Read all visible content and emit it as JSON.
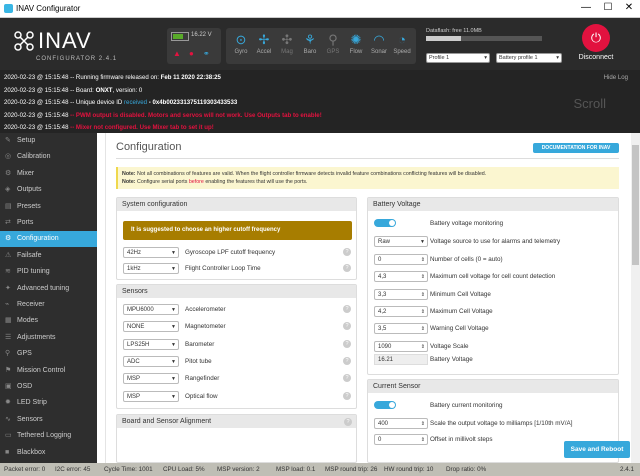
{
  "window": {
    "title": "INAV Configurator",
    "controls": [
      "—",
      "☐",
      "✕"
    ]
  },
  "header": {
    "logo_text": "INAV",
    "logo_sub": "CONFIGURATOR 2.4.1",
    "battery": {
      "voltage": "16.22 V",
      "level": 0.75
    },
    "sensors": [
      {
        "name": "Gyro",
        "icon": "gyro-icon",
        "glyph": "⊙",
        "active": true
      },
      {
        "name": "Accel",
        "icon": "accel-icon",
        "glyph": "✢",
        "active": true
      },
      {
        "name": "Mag",
        "icon": "mag-icon",
        "glyph": "✣",
        "active": false
      },
      {
        "name": "Baro",
        "icon": "baro-icon",
        "glyph": "⚘",
        "active": true
      },
      {
        "name": "GPS",
        "icon": "gps-icon",
        "glyph": "⚲",
        "active": false
      },
      {
        "name": "Flow",
        "icon": "flow-icon",
        "glyph": "✺",
        "active": true
      },
      {
        "name": "Sonar",
        "icon": "sonar-icon",
        "glyph": "◠",
        "active": true
      },
      {
        "name": "Speed",
        "icon": "speed-icon",
        "glyph": "◔",
        "active": true
      }
    ],
    "dataflash": {
      "label": "Dataflash: free 11.0MB",
      "fraction": 0.3
    },
    "profile": "Profile 1",
    "battery_profile": "Battery profile 1",
    "disconnect_label": "Disconnect",
    "accent": "#e2123f"
  },
  "log": {
    "hide": "Hide Log",
    "scroll": "Scroll",
    "lines": [
      {
        "ts": "2020-02-23 @ 15:15:48",
        "msg": "-- Running firmware released on: ",
        "val": "Feb 11 2020 22:38:25",
        "type": "normal"
      },
      {
        "ts": "2020-02-23 @ 15:15:48",
        "msg": "-- Board: ",
        "val": "ONXT",
        "tail": ", version: 0",
        "type": "normal"
      },
      {
        "ts": "2020-02-23 @ 15:15:48",
        "msg": "-- Unique device ID ",
        "blue": "received",
        "val": " - 0x4b002331375119303433533",
        "type": "normal"
      },
      {
        "ts": "2020-02-23 @ 15:15:48",
        "msg": "-- PWM output is disabled. Motors and servos will not work. Use Outputs tab to enable!",
        "type": "warn"
      },
      {
        "ts": "2020-02-23 @ 15:15:48",
        "msg": "-- Mixer not configured. Use Mixer tab to set it up!",
        "type": "warn"
      }
    ]
  },
  "sidebar": {
    "items": [
      {
        "label": "Setup",
        "icon": "wrench-icon",
        "glyph": "✎"
      },
      {
        "label": "Calibration",
        "icon": "calibration-icon",
        "glyph": "◎"
      },
      {
        "label": "Mixer",
        "icon": "mixer-icon",
        "glyph": "⚙"
      },
      {
        "label": "Outputs",
        "icon": "outputs-icon",
        "glyph": "◈"
      },
      {
        "label": "Presets",
        "icon": "presets-icon",
        "glyph": "▤"
      },
      {
        "label": "Ports",
        "icon": "ports-icon",
        "glyph": "⇄"
      },
      {
        "label": "Configuration",
        "icon": "gear-icon",
        "glyph": "⚙",
        "active": true
      },
      {
        "label": "Failsafe",
        "icon": "failsafe-icon",
        "glyph": "⚠"
      },
      {
        "label": "PID tuning",
        "icon": "pid-icon",
        "glyph": "≋"
      },
      {
        "label": "Advanced tuning",
        "icon": "advanced-icon",
        "glyph": "✦"
      },
      {
        "label": "Receiver",
        "icon": "receiver-icon",
        "glyph": "⌁"
      },
      {
        "label": "Modes",
        "icon": "modes-icon",
        "glyph": "▦"
      },
      {
        "label": "Adjustments",
        "icon": "adjustments-icon",
        "glyph": "☰"
      },
      {
        "label": "GPS",
        "icon": "gps-icon",
        "glyph": "⚲"
      },
      {
        "label": "Mission Control",
        "icon": "mission-icon",
        "glyph": "⚑"
      },
      {
        "label": "OSD",
        "icon": "osd-icon",
        "glyph": "▣"
      },
      {
        "label": "LED Strip",
        "icon": "led-icon",
        "glyph": "✹"
      },
      {
        "label": "Sensors",
        "icon": "sensors-icon",
        "glyph": "∿"
      },
      {
        "label": "Tethered Logging",
        "icon": "logging-icon",
        "glyph": "▭"
      },
      {
        "label": "Blackbox",
        "icon": "blackbox-icon",
        "glyph": "■"
      }
    ]
  },
  "content": {
    "title": "Configuration",
    "doc_button": "DOCUMENTATION FOR INAV",
    "note1_b": "Note:",
    "note1": " Not all combinations of features are valid. When the flight controller firmware detects invalid feature combinations conflicting features will be disabled.",
    "note2_b": "Note:",
    "note2_a": " Configure serial ports ",
    "note2_w": "before",
    "note2_c": " enabling the features that will use the ports.",
    "system": {
      "title": "System configuration",
      "warn": "It is suggested to choose an higher cutoff frequency",
      "rows": [
        {
          "value": "42Hz",
          "label": "Gyroscope LPF cutoff frequency"
        },
        {
          "value": "1kHz",
          "label": "Flight Controller Loop Time"
        }
      ]
    },
    "sensors": {
      "title": "Sensors",
      "rows": [
        {
          "value": "MPU6000",
          "label": "Accelerometer"
        },
        {
          "value": "NONE",
          "label": "Magnetometer"
        },
        {
          "value": "LPS25H",
          "label": "Barometer"
        },
        {
          "value": "ADC",
          "label": "Pitot tube"
        },
        {
          "value": "MSP",
          "label": "Rangefinder"
        },
        {
          "value": "MSP",
          "label": "Optical flow"
        }
      ]
    },
    "board": {
      "title": "Board and Sensor Alignment"
    },
    "battery": {
      "title": "Battery Voltage",
      "monitoring": "Battery voltage monitoring",
      "source": {
        "value": "Raw",
        "label": "Voltage source to use for alarms and telemetry"
      },
      "rows": [
        {
          "value": "0",
          "label": "Number of cells (0 = auto)"
        },
        {
          "value": "4,3",
          "label": "Maximum cell voltage for cell count detection"
        },
        {
          "value": "3,3",
          "label": "Minimum Cell Voltage"
        },
        {
          "value": "4,2",
          "label": "Maximum Cell Voltage"
        },
        {
          "value": "3,5",
          "label": "Warning Cell Voltage"
        },
        {
          "value": "1090",
          "label": "Voltage Scale"
        }
      ],
      "readout": {
        "value": "16.21",
        "label": "Battery Voltage"
      }
    },
    "current": {
      "title": "Current Sensor",
      "monitoring": "Battery current monitoring",
      "rows": [
        {
          "value": "400",
          "label": "Scale the output voltage to milliamps [1/10th mV/A]"
        },
        {
          "value": "0",
          "label": "Offset in millivolt steps"
        }
      ]
    },
    "save": "Save and Reboot"
  },
  "status": {
    "items": [
      "Packet error: 0",
      "I2C error: 45",
      "Cycle Time: 1001",
      "CPU Load: 5%",
      "MSP version: 2",
      "MSP load: 0.1",
      "MSP round trip: 26",
      "HW round trip: 10",
      "Drop ratio: 0%"
    ],
    "version": "2.4.1"
  }
}
